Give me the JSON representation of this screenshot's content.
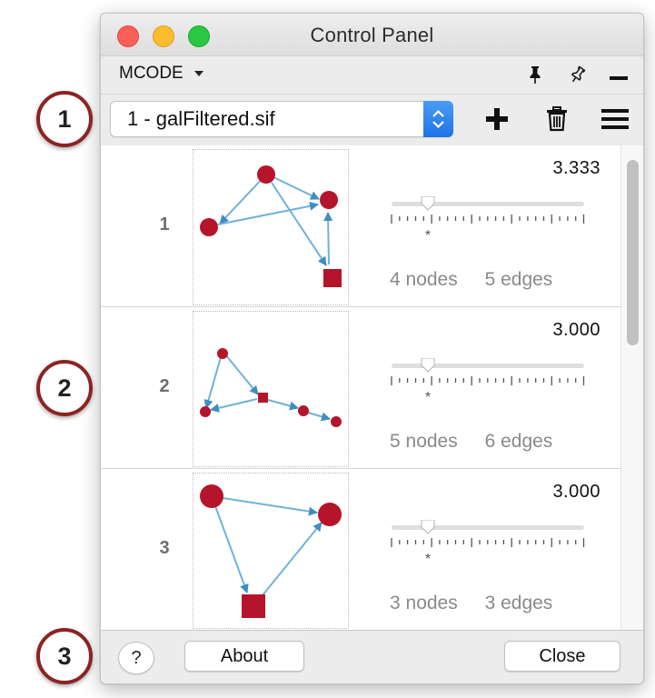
{
  "window": {
    "title": "Control Panel"
  },
  "menu": {
    "app_label": "MCODE"
  },
  "toolbar": {
    "network_selected": "1 - galFiltered.sif"
  },
  "clusters": [
    {
      "rank": "1",
      "score": "3.333",
      "nodes_label": "4 nodes",
      "edges_label": "5 edges",
      "slider_marker": "*",
      "slider_level": 0.2
    },
    {
      "rank": "2",
      "score": "3.000",
      "nodes_label": "5 nodes",
      "edges_label": "6 edges",
      "slider_marker": "*",
      "slider_level": 0.2
    },
    {
      "rank": "3",
      "score": "3.000",
      "nodes_label": "3 nodes",
      "edges_label": "3 edges",
      "slider_marker": "*",
      "slider_level": 0.2
    }
  ],
  "footer": {
    "help_label": "?",
    "about_label": "About",
    "close_label": "Close"
  },
  "callouts": [
    "1",
    "2",
    "3"
  ],
  "colors": {
    "node": "#b5152b",
    "edge": "#6fb2d8",
    "select_accent": "#2f82ee"
  },
  "icons": [
    "pin-icon",
    "unpin-icon",
    "minimize-icon",
    "add-icon",
    "trash-icon",
    "hamburger-menu-icon",
    "chevron-updown-icon"
  ]
}
